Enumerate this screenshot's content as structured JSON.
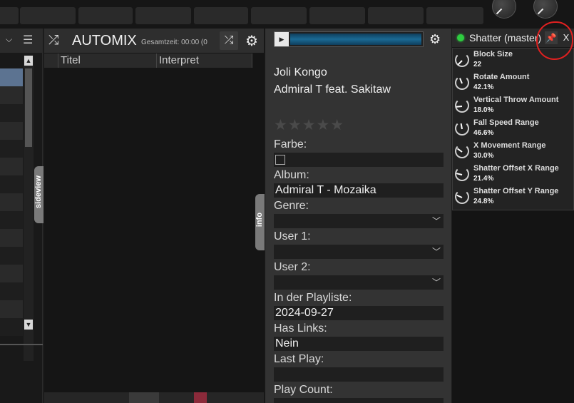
{
  "automix": {
    "title": "AUTOMIX",
    "total_label": "Gesamtzeit: 00:00 (0",
    "columns": [
      "Titel",
      "Interpret"
    ]
  },
  "sideview": {
    "label": "sideview"
  },
  "info_tab": {
    "label": "info"
  },
  "track": {
    "title": "Joli Kongo",
    "artist": "Admiral T feat. Sakitaw",
    "rating_stars": "★★★★★",
    "rating": 0
  },
  "fields": {
    "farbe": {
      "label": "Farbe:",
      "value": ""
    },
    "album": {
      "label": "Album:",
      "value": "Admiral T - Mozaika"
    },
    "genre": {
      "label": "Genre:",
      "value": ""
    },
    "user1": {
      "label": "User 1:",
      "value": ""
    },
    "user2": {
      "label": "User 2:",
      "value": ""
    },
    "playlist": {
      "label": "In der Playliste:",
      "value": "2024-09-27"
    },
    "links": {
      "label": "Has Links:",
      "value": "Nein"
    },
    "lastplay": {
      "label": "Last Play:",
      "value": ""
    },
    "playcount": {
      "label": "Play Count:",
      "value": ""
    }
  },
  "effect": {
    "title": "Shatter (master)",
    "close_label": "X",
    "led_color": "#2ecc40",
    "params": [
      {
        "name": "Block Size",
        "value": "22"
      },
      {
        "name": "Rotate Amount",
        "value": "42.1%"
      },
      {
        "name": "Vertical Throw Amount",
        "value": "18.0%"
      },
      {
        "name": "Fall Speed Range",
        "value": "46.6%"
      },
      {
        "name": "X Movement Range",
        "value": "30.0%"
      },
      {
        "name": "Shatter Offset X Range",
        "value": "21.4%"
      },
      {
        "name": "Shatter Offset Y Range",
        "value": "24.8%"
      }
    ]
  },
  "icons": {
    "shuffle": "⤮",
    "gear": "⚙",
    "pin": "📌",
    "play": "▶",
    "dropdown": "﹀",
    "scroll_up": "▲",
    "scroll_down": "▼",
    "chevron": "⌵",
    "list": "☰"
  },
  "colors": {
    "annotation_circle": "#e02020",
    "waveform": "#1b6a94"
  }
}
